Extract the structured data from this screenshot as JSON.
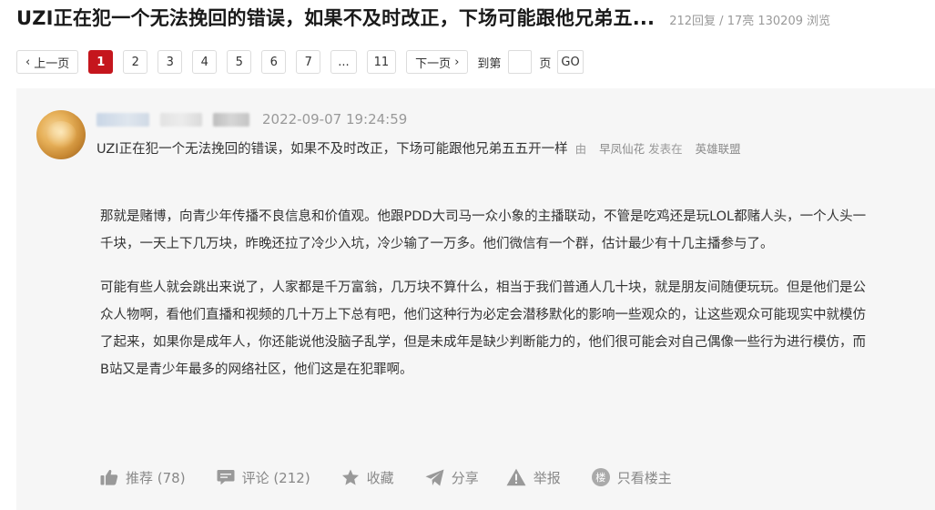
{
  "header": {
    "title": "UZI正在犯一个无法挽回的错误，如果不及时改正，下场可能跟他兄弟五...",
    "stats": "212回复 / 17亮 130209 浏览"
  },
  "pager": {
    "prev": "上一页",
    "pages": [
      "1",
      "2",
      "3",
      "4",
      "5",
      "6",
      "7",
      "...",
      "11"
    ],
    "current": "1",
    "next": "下一页",
    "goto_label": "到第",
    "page_unit": "页",
    "go": "GO"
  },
  "post": {
    "time": "2022-09-07 19:24:59",
    "subject": "UZI正在犯一个无法挽回的错误，如果不及时改正，下场可能跟他兄弟五五开一样",
    "meta_by": "由",
    "meta_author": "早凤仙花",
    "meta_posted_in": "发表在",
    "meta_forum": "英雄联盟",
    "paragraphs": [
      "那就是赌博，向青少年传播不良信息和价值观。他跟PDD大司马一众小象的主播联动，不管是吃鸡还是玩LOL都赌人头，一个人头一千块，一天上下几万块，昨晚还拉了冷少入坑，冷少输了一万多。他们微信有一个群，估计最少有十几主播参与了。",
      "可能有些人就会跳出来说了，人家都是千万富翁，几万块不算什么，相当于我们普通人几十块，就是朋友间随便玩玩。但是他们是公众人物啊，看他们直播和视频的几十万上下总有吧，他们这种行为必定会潜移默化的影响一些观众的，让这些观众可能现实中就模仿了起来，如果你是成年人，你还能说他没脑子乱学，但是未成年是缺少判断能力的，他们很可能会对自己偶像一些行为进行模仿，而B站又是青少年最多的网络社区，他们这是在犯罪啊。"
    ]
  },
  "actions": {
    "recommend": "推荐 (78)",
    "comment": "评论 (212)",
    "favorite": "收藏",
    "share": "分享",
    "report": "举报",
    "op_only": "只看楼主",
    "op_badge": "楼"
  },
  "colors": {
    "accent": "#c5161d",
    "muted": "#999999",
    "post_bg": "#f6f6f6"
  }
}
